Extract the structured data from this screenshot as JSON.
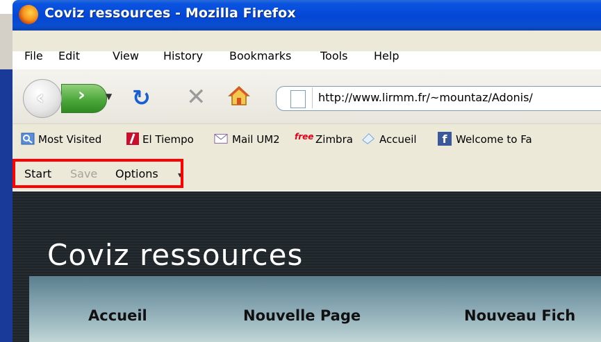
{
  "window": {
    "title": "Coviz ressources - Mozilla Firefox"
  },
  "menu": {
    "items": [
      {
        "label": "File"
      },
      {
        "label": "Edit"
      },
      {
        "label": "View"
      },
      {
        "label": "History"
      },
      {
        "label": "Bookmarks"
      },
      {
        "label": "Tools"
      },
      {
        "label": "Help"
      }
    ]
  },
  "navigation": {
    "url": "http://www.lirmm.fr/~mountaz/Adonis/",
    "icons": [
      "back-icon",
      "forward-icon",
      "history-dropdown-icon",
      "reload-icon",
      "stop-icon",
      "home-icon",
      "page-icon"
    ]
  },
  "bookmarks": {
    "items": [
      {
        "label": "Most Visited",
        "icon": "most-visited-icon"
      },
      {
        "label": "El Tiempo",
        "icon": "el-tiempo-icon"
      },
      {
        "label": "Mail UM2",
        "icon": "mail-icon"
      },
      {
        "label": "Zimbra",
        "icon": "zimbra-icon",
        "icon_text": "free"
      },
      {
        "label": "Accueil",
        "icon": "accueil-icon"
      },
      {
        "label": "Welcome to Fa",
        "icon": "facebook-icon",
        "icon_text": "f"
      }
    ]
  },
  "addon_toolbar": {
    "start": "Start",
    "save": "Save",
    "options": "Options",
    "highlight_color": "#ff0000"
  },
  "site": {
    "title": "Coviz ressources",
    "nav": [
      {
        "label": "Accueil"
      },
      {
        "label": "Nouvelle Page"
      },
      {
        "label": "Nouveau Fich"
      }
    ]
  },
  "colors": {
    "titlebar": "#0446d6",
    "menubar": "#ece9d8",
    "page_background": "#1e2428",
    "site_nav": "#86a6b2"
  }
}
